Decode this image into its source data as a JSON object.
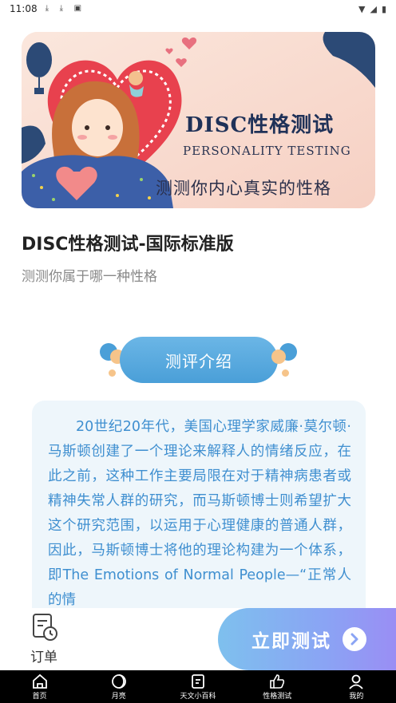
{
  "status_bar": {
    "time": "11:08"
  },
  "banner": {
    "title": "DISC性格测试",
    "subtitle": "PERSONALITY TESTING",
    "tagline": "测测你内心真实的性格"
  },
  "main": {
    "title": "DISC性格测试-国际标准版",
    "subtitle": "测测你属于哪一种性格",
    "section_label": "测评介绍",
    "intro_text": "20世纪20年代，美国心理学家威廉·莫尔顿·马斯顿创建了一个理论来解释人的情绪反应，在此之前，这种工作主要局限在对于精神病患者或精神失常人群的研究，而马斯顿博士则希望扩大这个研究范围，以运用于心理健康的普通人群，因此，马斯顿博士将他的理论构建为一个体系，即The Emotions of Normal People—“正常人的情"
  },
  "actions": {
    "orders_label": "订单",
    "start_label": "立即测试"
  },
  "nav": [
    {
      "label": "首页",
      "icon": "home-icon"
    },
    {
      "label": "月亮",
      "icon": "moon-icon"
    },
    {
      "label": "天文小百科",
      "icon": "book-icon"
    },
    {
      "label": "性格测试",
      "icon": "thumbs-up-icon"
    },
    {
      "label": "我的",
      "icon": "user-icon"
    }
  ],
  "colors": {
    "accent_blue": "#4a9fd8",
    "intro_text": "#3f8fd0",
    "banner_navy": "#1f3158"
  }
}
